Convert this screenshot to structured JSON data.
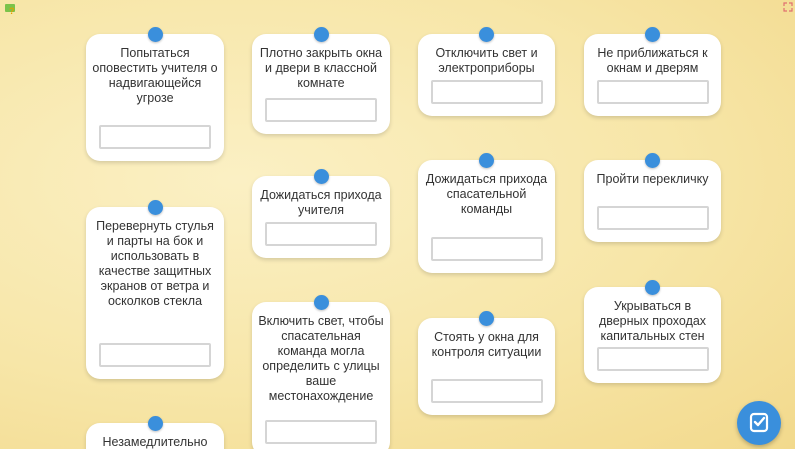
{
  "cards": [
    {
      "id": "c1",
      "text": "Попытаться оповестить учителя о надвигающейся угрозе"
    },
    {
      "id": "c2",
      "text": "Плотно закрыть окна и двери в классной комнате"
    },
    {
      "id": "c3",
      "text": "Отключить свет и электроприборы"
    },
    {
      "id": "c4",
      "text": "Не приближаться к окнам и дверям"
    },
    {
      "id": "c5",
      "text": "Дожидаться прихода учителя"
    },
    {
      "id": "c6",
      "text": "Дожидаться прихода спасательной команды"
    },
    {
      "id": "c7",
      "text": "Пройти перекличку"
    },
    {
      "id": "c8",
      "text": "Перевернуть стулья и парты на бок и использовать в качестве защитных экранов от ветра и осколков стекла"
    },
    {
      "id": "c9",
      "text": "Включить свет, чтобы спасательная команда могла определить с улицы ваше местонахождение"
    },
    {
      "id": "c10",
      "text": "Стоять у окна для контроля ситуации"
    },
    {
      "id": "c11",
      "text": "Укрываться в дверных проходах капитальных стен"
    },
    {
      "id": "c12",
      "text": "Незамедлительно"
    }
  ],
  "icons": {
    "top_left": "help-icon",
    "top_right": "fullscreen-icon",
    "check": "check-icon"
  },
  "colors": {
    "accent": "#3a8fdc",
    "background": "#f7e6a8",
    "card": "#ffffff",
    "text": "#333333"
  }
}
